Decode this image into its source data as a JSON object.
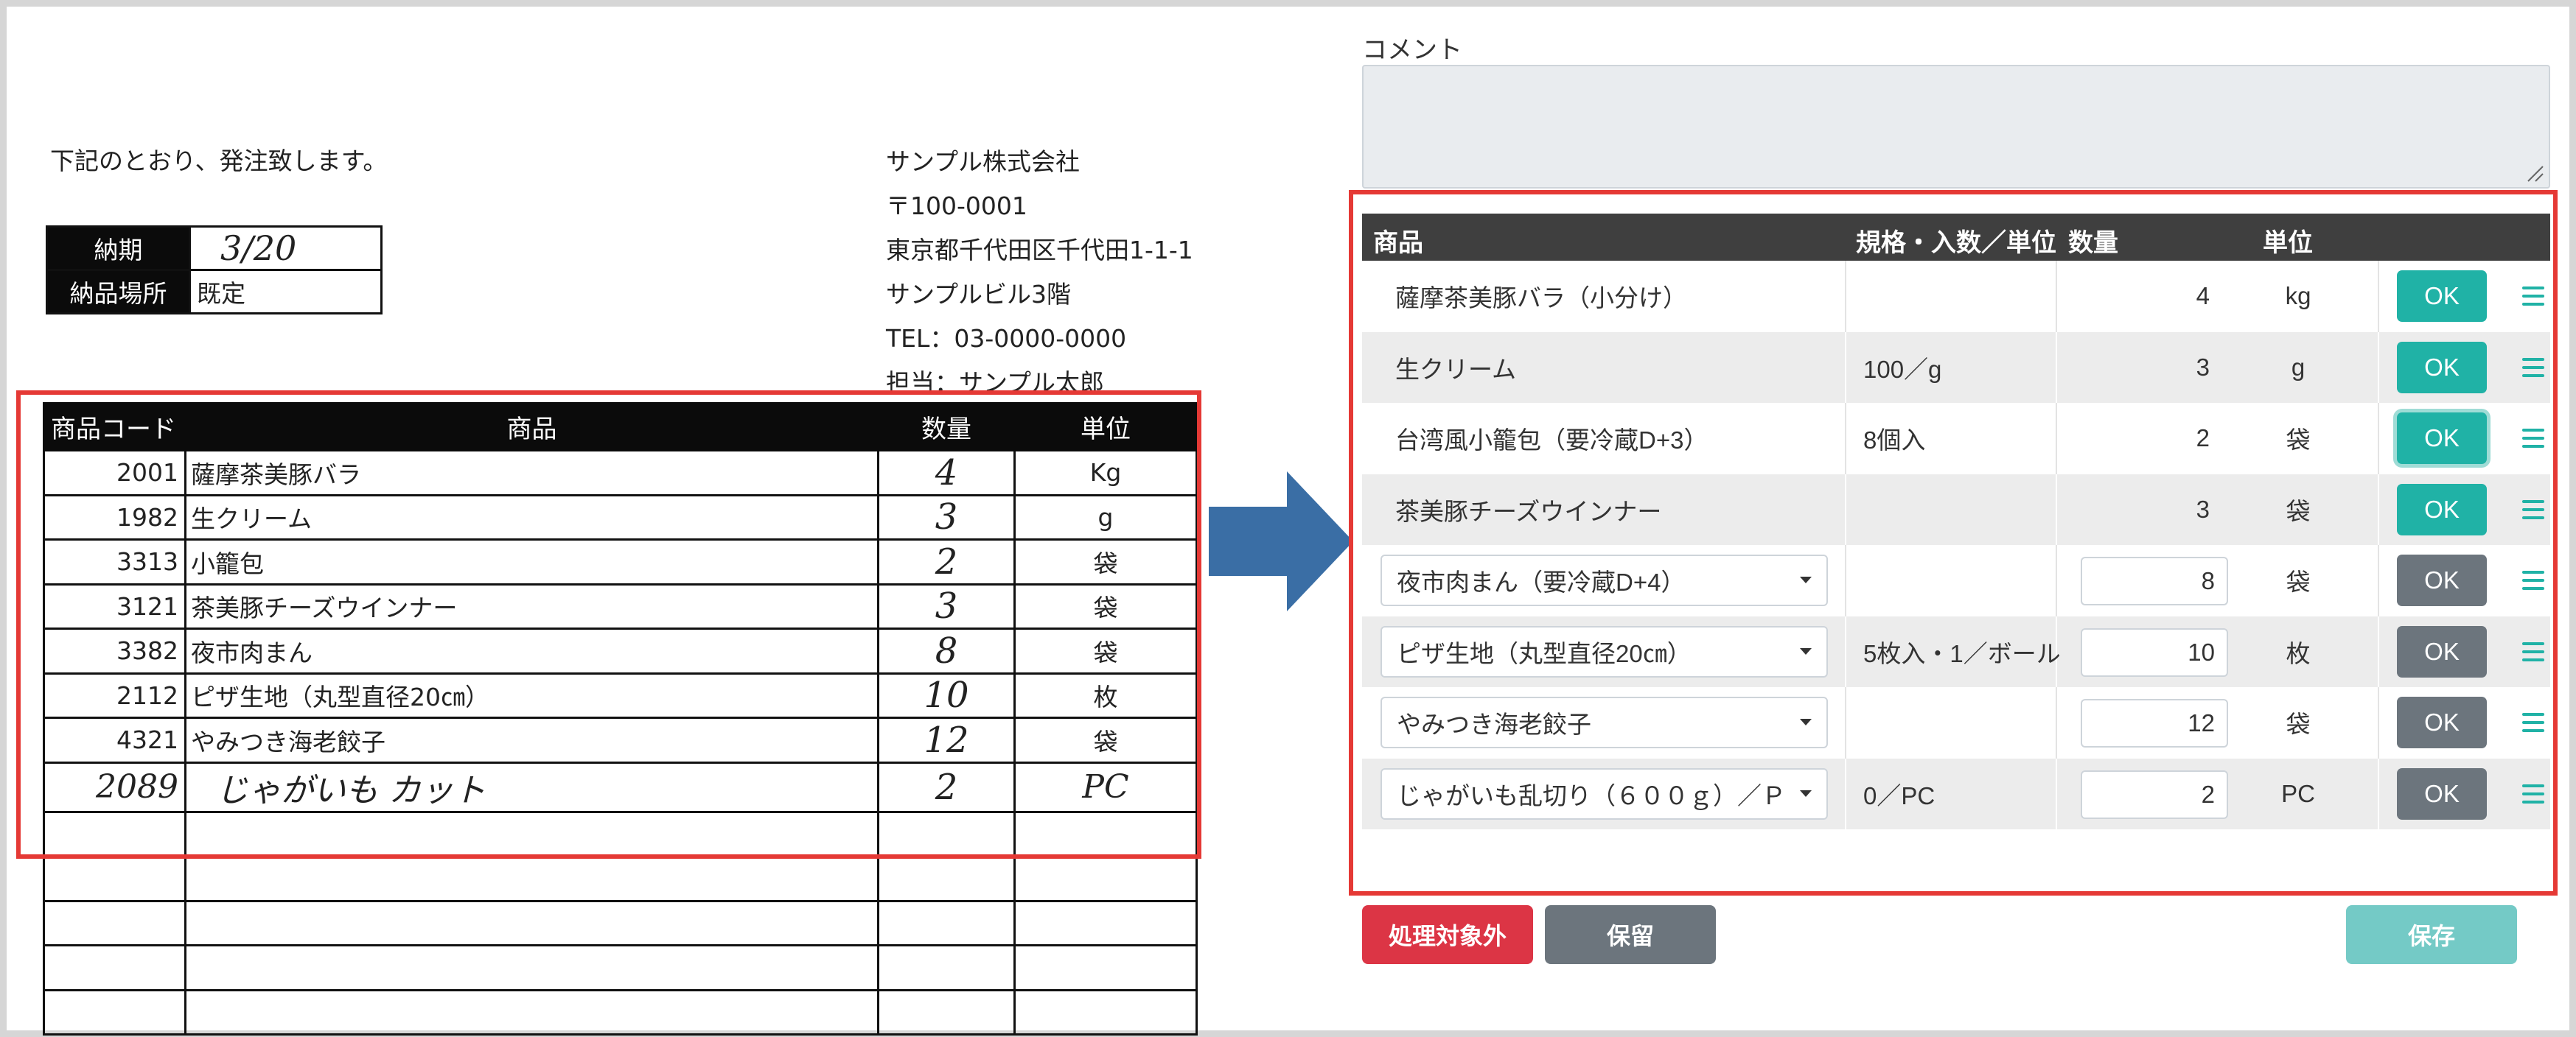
{
  "order_form": {
    "intro": "下記のとおり、発注致します。",
    "sender": {
      "company": "サンプル株式会社",
      "zip": "〒100-0001",
      "address": "東京都千代田区千代田1-1-1",
      "building": "サンプルビル3階",
      "tel": "TEL：03-0000-0000",
      "contact": "担当：サンプル太郎"
    },
    "meta": {
      "delivery_date_label": "納期",
      "delivery_date_value": "3/20",
      "delivery_place_label": "納品場所",
      "delivery_place_value": "既定"
    },
    "columns": {
      "code": "商品コード",
      "product": "商品",
      "qty": "数量",
      "unit": "単位"
    },
    "rows": [
      {
        "code": "2001",
        "product": "薩摩茶美豚バラ",
        "qty": "4",
        "unit": "Kg"
      },
      {
        "code": "1982",
        "product": "生クリーム",
        "qty": "3",
        "unit": "g"
      },
      {
        "code": "3313",
        "product": "小籠包",
        "qty": "2",
        "unit": "袋"
      },
      {
        "code": "3121",
        "product": "茶美豚チーズウインナー",
        "qty": "3",
        "unit": "袋"
      },
      {
        "code": "3382",
        "product": "夜市肉まん",
        "qty": "8",
        "unit": "袋"
      },
      {
        "code": "2112",
        "product": "ピザ生地（丸型直径20㎝）",
        "qty": "10",
        "unit": "枚"
      },
      {
        "code": "4321",
        "product": "やみつき海老餃子",
        "qty": "12",
        "unit": "袋"
      },
      {
        "code": "2089",
        "product": "じゃがいも カット",
        "qty": "2",
        "unit": "PC"
      }
    ]
  },
  "app": {
    "comment_label": "コメント",
    "comment_value": "",
    "columns": {
      "product": "商品",
      "spec": "規格・入数／単位",
      "qty": "数量",
      "unit": "単位"
    },
    "ok_label": "OK",
    "rows": [
      {
        "product": "薩摩茶美豚バラ（小分け）",
        "spec": "",
        "qty": "4",
        "unit": "kg",
        "editable": false,
        "ok_style": "teal"
      },
      {
        "product": "生クリーム",
        "spec": "100／g",
        "qty": "3",
        "unit": "g",
        "editable": false,
        "ok_style": "teal"
      },
      {
        "product": "台湾風小籠包（要冷蔵D+3）",
        "spec": "8個入",
        "qty": "2",
        "unit": "袋",
        "editable": false,
        "ok_style": "teal-focus"
      },
      {
        "product": "茶美豚チーズウインナー",
        "spec": "",
        "qty": "3",
        "unit": "袋",
        "editable": false,
        "ok_style": "teal"
      },
      {
        "product": "夜市肉まん（要冷蔵D+4）",
        "spec": "",
        "qty": "8",
        "unit": "袋",
        "editable": true,
        "ok_style": "gray"
      },
      {
        "product": "ピザ生地（丸型直径20㎝）",
        "spec": "5枚入・1／ボール",
        "qty": "10",
        "unit": "枚",
        "editable": true,
        "ok_style": "gray"
      },
      {
        "product": "やみつき海老餃子",
        "spec": "",
        "qty": "12",
        "unit": "袋",
        "editable": true,
        "ok_style": "gray"
      },
      {
        "product": "じゃがいも乱切り（６００ｇ）／Ｐ",
        "spec": "0／PC",
        "qty": "2",
        "unit": "PC",
        "editable": true,
        "ok_style": "gray"
      }
    ],
    "buttons": {
      "exclude": "処理対象外",
      "hold": "保留",
      "save": "保存"
    }
  },
  "colors": {
    "highlight_red": "#e53935",
    "arrow_blue": "#3a6ea5",
    "ok_teal": "#20b2a6",
    "ok_gray": "#6c757d",
    "exclude_red": "#dc3545",
    "save_teal_disabled": "#74cac6"
  },
  "icons": {
    "arrow": "right-arrow-icon",
    "row_menu": "hamburger-menu-icon",
    "select_caret": "caret-down-icon",
    "resize": "resize-handle-icon"
  }
}
